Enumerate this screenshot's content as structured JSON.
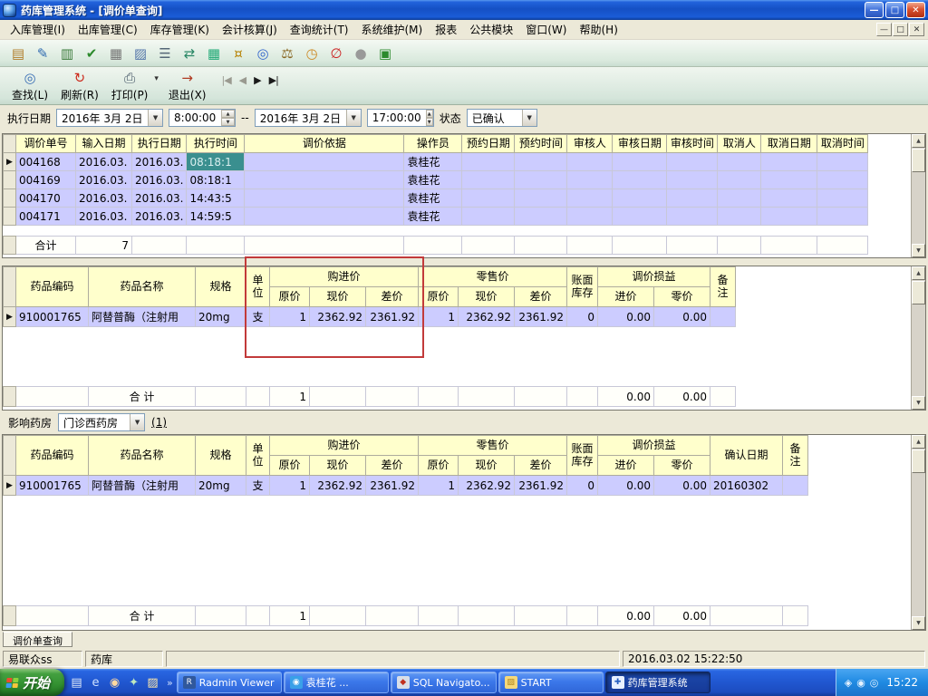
{
  "window": {
    "title": "药库管理系统 - [调价单查询]",
    "buttons": {
      "minimize": "—",
      "restore": "□",
      "close": "✕"
    }
  },
  "menu": {
    "items": [
      "入库管理(I)",
      "出库管理(C)",
      "库存管理(K)",
      "会计核算(J)",
      "查询统计(T)",
      "系统维护(M)",
      "报表",
      "公共模块",
      "窗口(W)",
      "帮助(H)"
    ],
    "mdi": {
      "minimize": "—",
      "restore": "□",
      "close": "✕"
    }
  },
  "toolbar": {
    "icons": [
      {
        "name": "new-doc-icon",
        "glyph": "▤",
        "color": "#b07c28"
      },
      {
        "name": "edit-doc-icon",
        "glyph": "✎",
        "color": "#2f6bb0"
      },
      {
        "name": "save-doc-icon",
        "glyph": "▥",
        "color": "#3a7a3a"
      },
      {
        "name": "audit-icon",
        "glyph": "✔",
        "color": "#2c8a2c"
      },
      {
        "name": "notepad-icon",
        "glyph": "▦",
        "color": "#767676"
      },
      {
        "name": "card-file-icon",
        "glyph": "▨",
        "color": "#5577aa"
      },
      {
        "name": "ledger-icon",
        "glyph": "☰",
        "color": "#556677"
      },
      {
        "name": "transfer-icon",
        "glyph": "⇄",
        "color": "#2a8866"
      },
      {
        "name": "table-icon",
        "glyph": "▦",
        "color": "#22aa77"
      },
      {
        "name": "money-icon",
        "glyph": "¤",
        "color": "#b8860b"
      },
      {
        "name": "search-doc-icon",
        "glyph": "◎",
        "color": "#3366cc"
      },
      {
        "name": "balance-icon",
        "glyph": "⚖",
        "color": "#886622"
      },
      {
        "name": "clock-icon",
        "glyph": "◷",
        "color": "#cc8822"
      },
      {
        "name": "forbid-icon",
        "glyph": "∅",
        "color": "#cc2222"
      },
      {
        "name": "pause-icon",
        "glyph": "●",
        "color": "#999999"
      },
      {
        "name": "close-grid-icon",
        "glyph": "▣",
        "color": "#2c8a2c"
      }
    ]
  },
  "toolbar2": {
    "actions": [
      {
        "name": "find",
        "label": "查找(L)",
        "glyph": "◎",
        "color": "#3a6fb5"
      },
      {
        "name": "refresh",
        "label": "刷新(R)",
        "glyph": "↻",
        "color": "#cc2b1d"
      },
      {
        "name": "print",
        "label": "打印(P)",
        "glyph": "⎙",
        "color": "#445566",
        "dropdown": true
      },
      {
        "name": "exit",
        "label": "退出(X)",
        "glyph": "→",
        "color": "#b03a22"
      }
    ],
    "nav": [
      {
        "name": "first",
        "glyph": "|◀",
        "enabled": false
      },
      {
        "name": "prev",
        "glyph": "◀",
        "enabled": false
      },
      {
        "name": "next",
        "glyph": "▶",
        "enabled": true
      },
      {
        "name": "last",
        "glyph": "▶|",
        "enabled": true
      }
    ]
  },
  "filter": {
    "label": "执行日期",
    "date_from": "2016年 3月 2日",
    "time_from": "8:00:00",
    "separator": "--",
    "date_to": "2016年 3月 2日",
    "time_to": "17:00:00",
    "status_label": "状态",
    "status_value": "已确认"
  },
  "top_grid": {
    "widths": [
      14,
      66,
      62,
      60,
      64,
      176,
      64,
      58,
      58,
      50,
      60,
      56,
      48,
      62,
      56
    ],
    "columns": [
      "调价单号",
      "输入日期",
      "执行日期",
      "执行时间",
      "调价依据",
      "操作员",
      "预约日期",
      "预约时间",
      "审核人",
      "审核日期",
      "审核时间",
      "取消人",
      "取消日期",
      "取消时间"
    ],
    "rows": [
      {
        "current": true,
        "sel": 3,
        "cells": [
          "004168",
          "2016.03.",
          "2016.03.",
          "08:18:1",
          "",
          "袁桂花",
          "",
          "",
          "",
          "",
          "",
          "",
          "",
          ""
        ]
      },
      {
        "cells": [
          "004169",
          "2016.03.",
          "2016.03.",
          "08:18:1",
          "",
          "袁桂花",
          "",
          "",
          "",
          "",
          "",
          "",
          "",
          ""
        ]
      },
      {
        "cells": [
          "004170",
          "2016.03.",
          "2016.03.",
          "14:43:5",
          "",
          "袁桂花",
          "",
          "",
          "",
          "",
          "",
          "",
          "",
          ""
        ]
      },
      {
        "cells": [
          "004171",
          "2016.03.",
          "2016.03.",
          "14:59:5",
          "",
          "袁桂花",
          "",
          "",
          "",
          "",
          "",
          "",
          "",
          ""
        ]
      }
    ],
    "filler": 12,
    "total": [
      "合计",
      "7",
      "",
      "",
      "",
      "",
      "",
      "",
      "",
      "",
      "",
      "",
      "",
      ""
    ]
  },
  "mid_grid": {
    "widths": [
      14,
      80,
      118,
      56,
      26,
      44,
      62,
      58,
      44,
      62,
      58,
      34,
      62,
      62,
      28
    ],
    "header": {
      "top": [
        {
          "label": "药品编码",
          "rowspan": 2
        },
        {
          "label": "药品名称",
          "rowspan": 2
        },
        {
          "label": "规格",
          "rowspan": 2
        },
        {
          "label": "单位",
          "rowspan": 2
        },
        {
          "label": "购进价",
          "colspan": 3
        },
        {
          "label": "零售价",
          "colspan": 3
        },
        {
          "label": "账面库存",
          "rowspan": 2
        },
        {
          "label": "调价损益",
          "colspan": 2
        },
        {
          "label": "备注",
          "rowspan": 2
        }
      ],
      "sub": [
        "原价",
        "现价",
        "差价",
        "原价",
        "现价",
        "差价",
        "进价",
        "零价"
      ]
    },
    "aligns": [
      "left",
      "left",
      "left",
      "center",
      "right",
      "right",
      "right",
      "right",
      "right",
      "right",
      "right",
      "right",
      "right",
      "left"
    ],
    "rows": [
      {
        "current": true,
        "cells": [
          "910001765",
          "阿替普酶（注射用",
          "20mg",
          "支",
          "1",
          "2362.92",
          "2361.92",
          "1",
          "2362.92",
          "2361.92",
          "0",
          "0.00",
          "0.00",
          ""
        ]
      }
    ],
    "filler": 66,
    "total": [
      "",
      "合  计",
      "",
      "",
      "1",
      "",
      "",
      "",
      "",
      "",
      "",
      "0.00",
      "0.00",
      ""
    ]
  },
  "pharmacy": {
    "label": "影响药房",
    "value": "门诊西药房",
    "count": "(1)"
  },
  "bottom_grid": {
    "widths": [
      14,
      80,
      118,
      56,
      26,
      44,
      62,
      58,
      44,
      62,
      58,
      34,
      62,
      62,
      80,
      28
    ],
    "header": {
      "top": [
        {
          "label": "药品编码",
          "rowspan": 2
        },
        {
          "label": "药品名称",
          "rowspan": 2
        },
        {
          "label": "规格",
          "rowspan": 2
        },
        {
          "label": "单位",
          "rowspan": 2
        },
        {
          "label": "购进价",
          "colspan": 3
        },
        {
          "label": "零售价",
          "colspan": 3
        },
        {
          "label": "账面库存",
          "rowspan": 2
        },
        {
          "label": "调价损益",
          "colspan": 2
        },
        {
          "label": "确认日期",
          "rowspan": 2
        },
        {
          "label": "备注",
          "rowspan": 2
        }
      ],
      "sub": [
        "原价",
        "现价",
        "差价",
        "原价",
        "现价",
        "差价",
        "进价",
        "零价"
      ]
    },
    "aligns": [
      "left",
      "left",
      "left",
      "center",
      "right",
      "right",
      "right",
      "right",
      "right",
      "right",
      "right",
      "right",
      "right",
      "left",
      "left"
    ],
    "rows": [
      {
        "current": true,
        "cells": [
          "910001765",
          "阿替普酶（注射用",
          "20mg",
          "支",
          "1",
          "2362.92",
          "2361.92",
          "1",
          "2362.92",
          "2361.92",
          "0",
          "0.00",
          "0.00",
          "20160302",
          ""
        ]
      }
    ],
    "filler": 122,
    "total": [
      "",
      "合  计",
      "",
      "",
      "1",
      "",
      "",
      "",
      "",
      "",
      "",
      "0.00",
      "0.00",
      "",
      ""
    ]
  },
  "tab": {
    "label": "调价单查询"
  },
  "statusbar": {
    "company": "易联众ss",
    "module": "药库",
    "timestamp": "2016.03.02 15:22:50"
  },
  "taskbar": {
    "start": "开始",
    "quick": [
      {
        "name": "show-desktop-icon",
        "glyph": "▤",
        "color": "#dfe8f8"
      },
      {
        "name": "ie-icon",
        "glyph": "e",
        "color": "#cfe2ff"
      },
      {
        "name": "media-player-icon",
        "glyph": "◉",
        "color": "#ffd9a0"
      },
      {
        "name": "messenger-icon",
        "glyph": "✦",
        "color": "#bfe8bf"
      },
      {
        "name": "folder-shortcut-icon",
        "glyph": "▨",
        "color": "#ffe9a8"
      }
    ],
    "overflow": "»",
    "tasks": [
      {
        "name": "task-radmin-viewer",
        "label": "Radmin Viewer",
        "glyph": "R",
        "icon_bg": "#30589c",
        "icon_color": "#ffffff"
      },
      {
        "name": "task-yuan-guihua",
        "label": "袁桂花      ...",
        "glyph": "◉",
        "icon_bg": "#3aa0e8",
        "icon_color": "#ffffff"
      },
      {
        "name": "task-sql-navigator",
        "label": "SQL Navigato...",
        "glyph": "◆",
        "icon_bg": "#d8dee8",
        "icon_color": "#c03020"
      },
      {
        "name": "task-start-folder",
        "label": "START",
        "glyph": "▨",
        "icon_bg": "#f5d87a",
        "icon_color": "#b08820"
      },
      {
        "name": "task-pharmacy-system",
        "label": "药库管理系统",
        "glyph": "✚",
        "icon_bg": "#e8f0ff",
        "icon_color": "#2860c0",
        "active": true
      }
    ],
    "tray": [
      {
        "name": "tray-antivirus-icon",
        "glyph": "◈"
      },
      {
        "name": "tray-network-icon",
        "glyph": "◉"
      },
      {
        "name": "tray-volume-icon",
        "glyph": "◎"
      }
    ],
    "time": "15:22"
  },
  "colors": {
    "annotation": "#c23a3a",
    "row_highlight": "#ccccff",
    "selected_cell": "#3a8f8f",
    "header_bg": "#ffffcc"
  }
}
